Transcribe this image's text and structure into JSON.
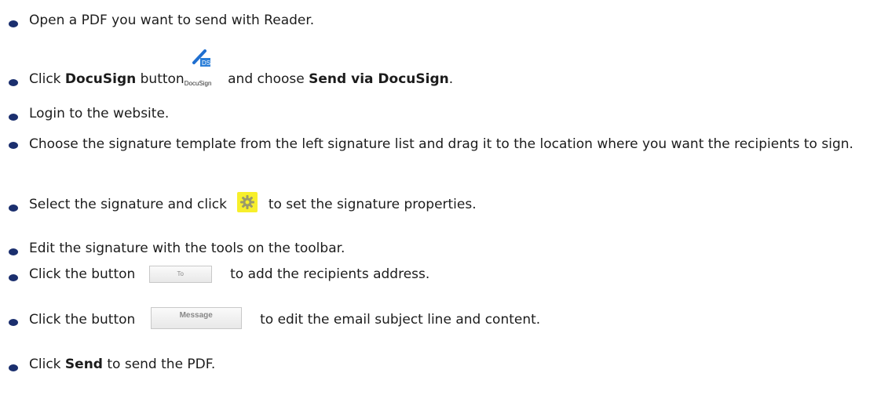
{
  "steps": [
    {
      "text": "Open a PDF you want to send with Reader."
    },
    {
      "pre": "Click ",
      "bold1": "DocuSign",
      "mid": " button",
      "icon_caption": "DocuSign",
      "post": " and choose ",
      "bold2": "Send via DocuSign",
      "end": "."
    },
    {
      "text": "Login to the website."
    },
    {
      "text": "Choose the signature template from the left signature list and drag it to the location where you want the recipients to sign."
    },
    {
      "pre": "Select the signature and click ",
      "post": " to set the signature properties."
    },
    {
      "text": "Edit the signature with the tools on the toolbar."
    },
    {
      "pre": "Click the button ",
      "button_label": "To",
      "post": " to add the recipients address."
    },
    {
      "pre": "Click the button ",
      "button_label": "Message",
      "post": " to edit the email subject line and content."
    },
    {
      "pre": "Click ",
      "bold": "Send",
      "post": " to send the PDF."
    }
  ],
  "icons": {
    "docusign": "docusign-pen-icon",
    "gear": "gear-icon"
  },
  "colors": {
    "bullet": "#1b2f6e",
    "gear_bg": "#f7ef2b"
  }
}
